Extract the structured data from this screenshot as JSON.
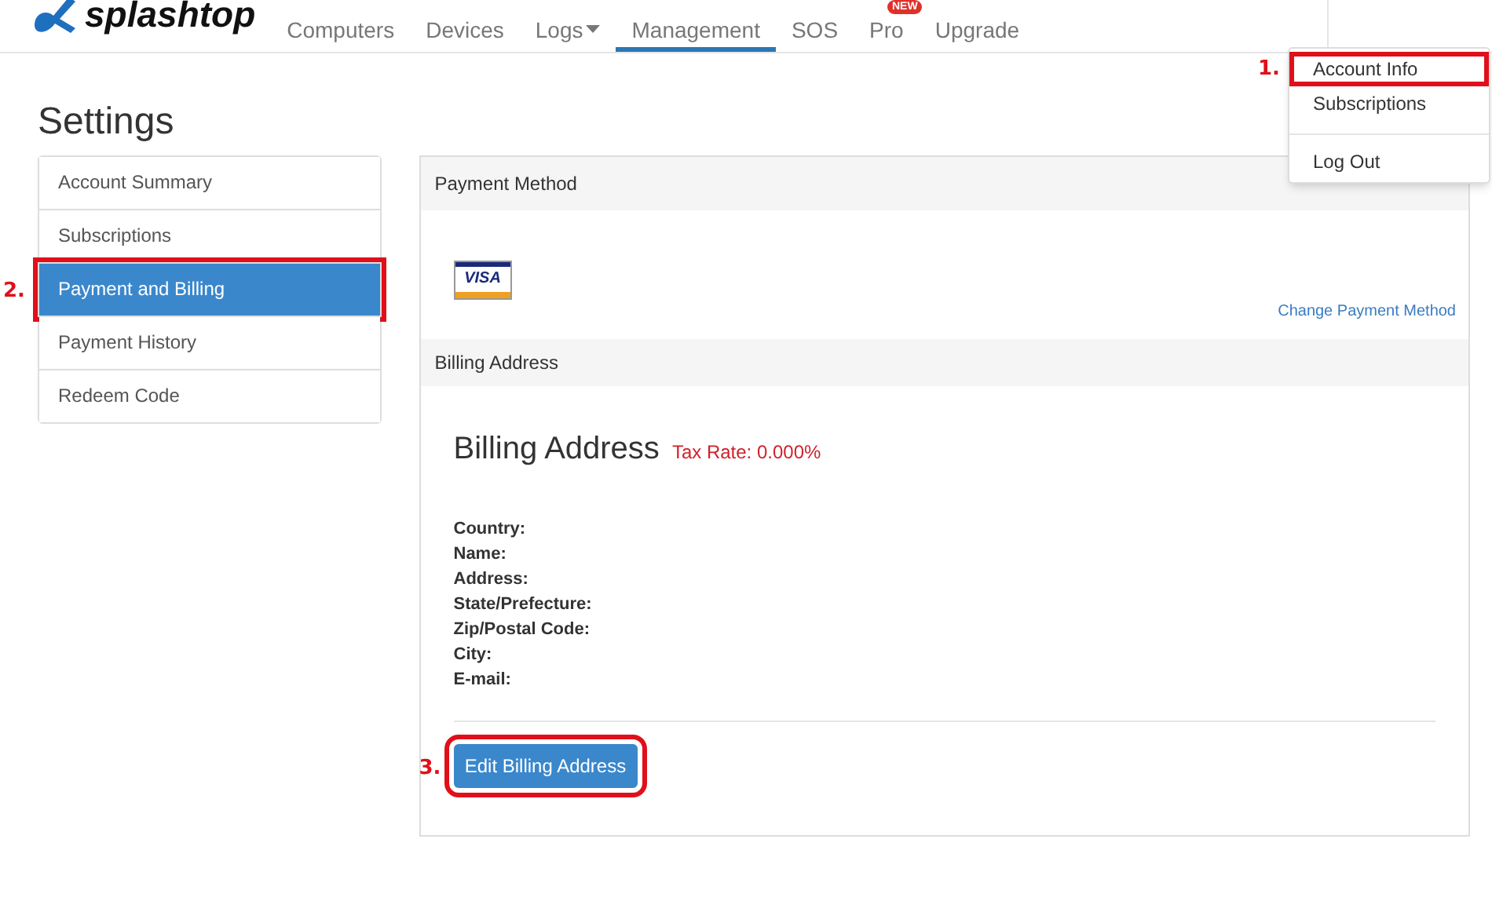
{
  "nav": {
    "logo": "splashtop",
    "items": [
      {
        "label": "Computers",
        "selected": false,
        "dropdown": false
      },
      {
        "label": "Devices",
        "selected": false,
        "dropdown": false
      },
      {
        "label": "Logs",
        "selected": false,
        "dropdown": true
      },
      {
        "label": "Management",
        "selected": true,
        "dropdown": false
      },
      {
        "label": "SOS",
        "selected": false,
        "dropdown": false
      },
      {
        "label": "Pro",
        "selected": false,
        "dropdown": false,
        "badge": "NEW"
      },
      {
        "label": "Upgrade",
        "selected": false,
        "dropdown": false
      }
    ]
  },
  "account_menu": {
    "groups": [
      [
        {
          "label": "Account Info",
          "callout": "1."
        },
        {
          "label": "Subscriptions"
        }
      ],
      [
        {
          "label": "Log Out"
        }
      ]
    ]
  },
  "page_title": "Settings",
  "sidebar": {
    "items": [
      {
        "label": "Account Summary",
        "selected": false
      },
      {
        "label": "Subscriptions",
        "selected": false
      },
      {
        "label": "Payment and Billing",
        "selected": true,
        "callout": "2."
      },
      {
        "label": "Payment History",
        "selected": false
      },
      {
        "label": "Redeem Code",
        "selected": false
      }
    ]
  },
  "payment_method": {
    "header": "Payment Method",
    "card": "VISA",
    "link": "Change Payment Method"
  },
  "billing_address": {
    "header": "Billing Address",
    "title": "Billing Address",
    "tax_rate": "Tax Rate: 0.000%",
    "fields": [
      "Country:",
      "Name:",
      "Address:",
      "State/Prefecture:",
      "Zip/Postal Code:",
      "City:",
      "E-mail:"
    ],
    "button": {
      "label": "Edit Billing Address",
      "callout": "3."
    }
  }
}
